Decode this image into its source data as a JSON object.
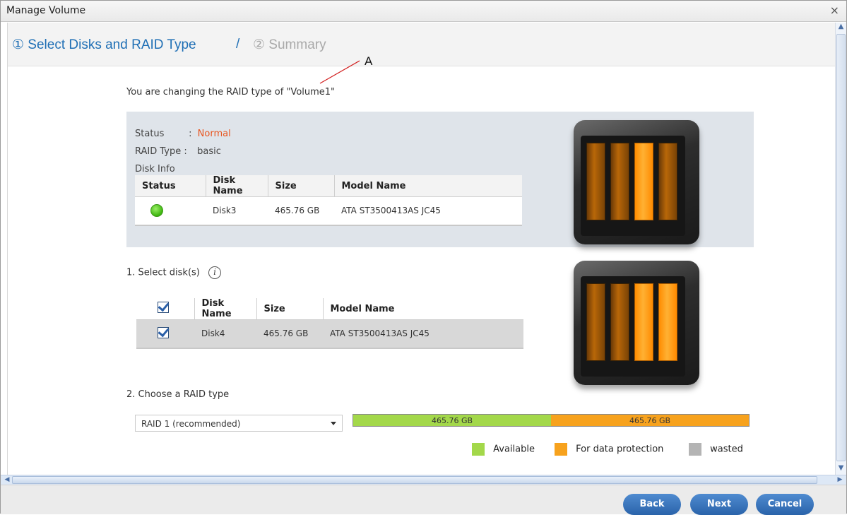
{
  "window": {
    "title": "Manage Volume",
    "close_glyph": "×"
  },
  "steps": {
    "step1": "① Select Disks and RAID Type",
    "separator": "/",
    "step2": "② Summary"
  },
  "annotation": {
    "letter": "A"
  },
  "intro_text": "You are changing the RAID type of \"Volume1\"",
  "current": {
    "status_label": "Status",
    "status_sep": ":",
    "status_value": "Normal",
    "raid_label": "RAID Type :",
    "raid_value": "basic",
    "disk_info_label": "Disk Info",
    "table": {
      "headers": [
        "Status",
        "Disk Name",
        "Size",
        "Model Name"
      ],
      "rows": [
        {
          "status_icon": "green-status-dot",
          "disk_name": "Disk3",
          "size": "465.76 GB",
          "model": "ATA ST3500413AS JC45"
        }
      ]
    }
  },
  "select_disks": {
    "label": "1. Select disk(s)",
    "info_glyph": "i",
    "table": {
      "headers": [
        "",
        "Disk Name",
        "Size",
        "Model Name"
      ],
      "header_checked": true,
      "rows": [
        {
          "checked": true,
          "disk_name": "Disk4",
          "size": "465.76 GB",
          "model": "ATA ST3500413AS JC45"
        }
      ]
    }
  },
  "raid": {
    "label": "2. Choose a RAID type",
    "selected": "RAID 1 (recommended)",
    "capacity": [
      {
        "label": "465.76 GB",
        "kind": "available",
        "fraction": 0.5,
        "color": "#a3d84a"
      },
      {
        "label": "465.76 GB",
        "kind": "protection",
        "fraction": 0.5,
        "color": "#f7a21d"
      }
    ],
    "legend": [
      {
        "label": "Available",
        "color": "#a3d84a"
      },
      {
        "label": "For data protection",
        "color": "#f7a21d"
      },
      {
        "label": "wasted",
        "color": "#b4b4b4"
      }
    ]
  },
  "nas_images": [
    {
      "lit_bays": [
        3
      ]
    },
    {
      "lit_bays": [
        3,
        4
      ]
    }
  ],
  "buttons": {
    "back": "Back",
    "next": "Next",
    "cancel": "Cancel"
  },
  "colors": {
    "accent": "#1f6fb5",
    "status_normal": "#e8551f",
    "button": "#2f6db4"
  }
}
